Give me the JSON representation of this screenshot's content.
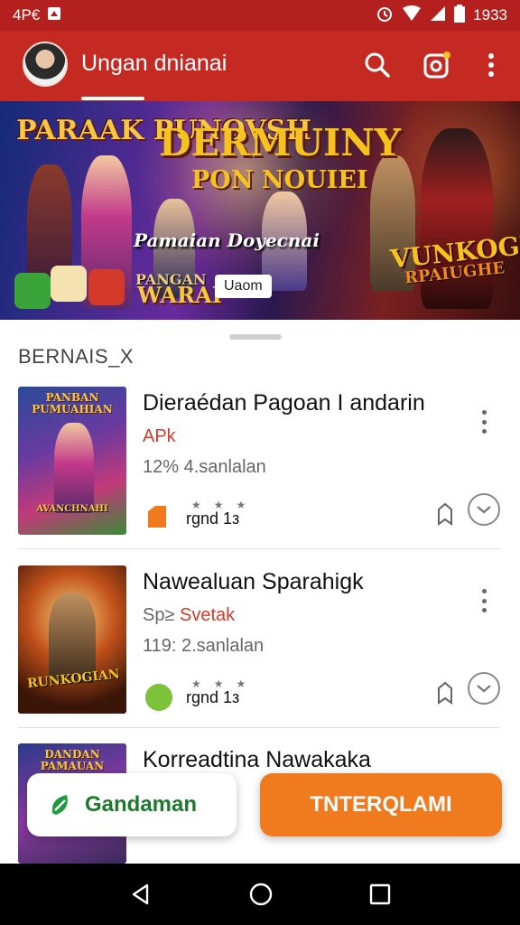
{
  "status_bar": {
    "left_text": "4P€",
    "time": "1933"
  },
  "app_bar": {
    "title": "Ungan dnianai"
  },
  "banner": {
    "logo": "PARAAK PUNOVSH",
    "headline": "DERMUINY",
    "subheadline": "PON NOUIEI",
    "caption": "Pamaian Doyecnai",
    "small_line1": "PANGAN",
    "small_line2": "WARAI",
    "chip_label": "Uaom",
    "right_title": "VUNKOGEIN",
    "right_subtitle": "RPAIUGHE"
  },
  "section": {
    "title": "BERNAIS_X"
  },
  "items": [
    {
      "title": "Dieraédan Pagoan I andarin",
      "tag_prefix": "",
      "tag": "APk",
      "meta": "12% 4.sanlalan",
      "rating": "rgnd 1з",
      "badge_color": "#f07a1e",
      "thumb_title": "PANBAN PUMUAHIAN",
      "thumb_caption": "AVANCHNAHI"
    },
    {
      "title": "Nawealuan Sparahigk",
      "tag_prefix": "Sp≥",
      "tag": "Svetak",
      "meta": "119: 2.sanlalan",
      "rating": "rgnd 1з",
      "badge_color": "#7cc23a",
      "thumb_title": "",
      "thumb_caption": "RUNKOGIAN"
    },
    {
      "title": "Korreadtina Nawakaka",
      "tag_prefix": "",
      "tag": "",
      "meta": "",
      "rating": "",
      "badge_color": "#7cc23a",
      "thumb_title": "DANDAN PAMAUAN",
      "thumb_caption": ""
    }
  ],
  "fab": {
    "left_label": "Gandaman",
    "right_label": "TNTERQLAMI"
  },
  "colors": {
    "primary": "#c52a22",
    "status": "#b3201e",
    "accent": "#f07a1e",
    "green": "#1d7a2c"
  }
}
